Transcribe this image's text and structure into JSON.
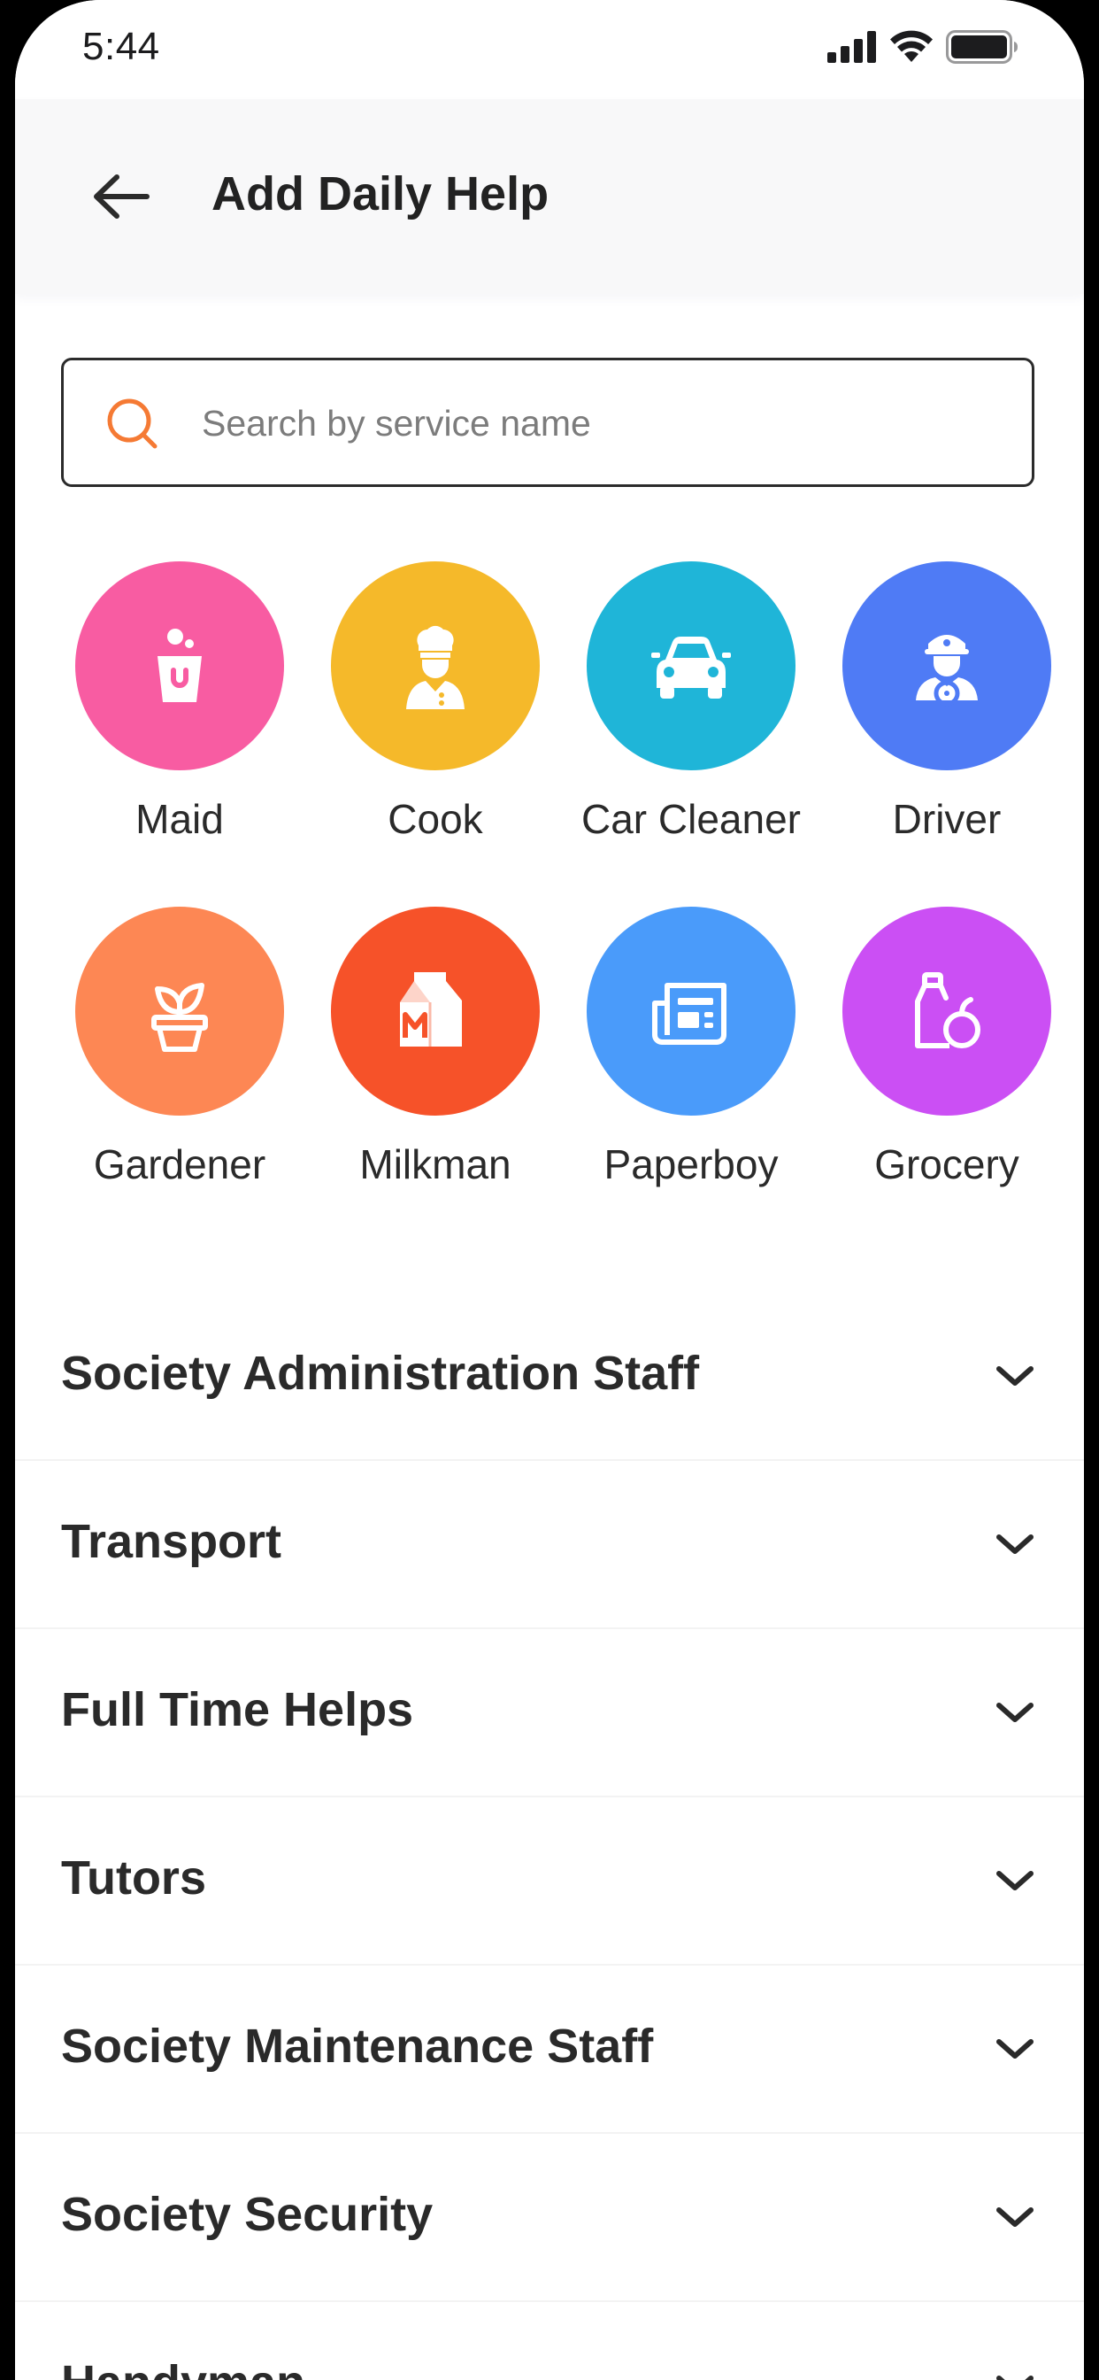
{
  "status_bar": {
    "time": "5:44",
    "icons": [
      "signal-icon",
      "wifi-icon",
      "battery-icon"
    ]
  },
  "header": {
    "back_icon": "arrow-left-icon",
    "title": "Add Daily Help"
  },
  "search": {
    "icon": "search-icon",
    "placeholder": "Search by service name",
    "value": ""
  },
  "services": [
    {
      "label": "Maid",
      "icon": "maid-icon",
      "color": "#F85CA2"
    },
    {
      "label": "Cook",
      "icon": "chef-icon",
      "color": "#F5B92A"
    },
    {
      "label": "Car Cleaner",
      "icon": "car-icon",
      "color": "#1FB5D8"
    },
    {
      "label": "Driver",
      "icon": "driver-icon",
      "color": "#4F7BF5"
    },
    {
      "label": "Gardener",
      "icon": "plant-pot-icon",
      "color": "#FD8754"
    },
    {
      "label": "Milkman",
      "icon": "milk-carton-icon",
      "color": "#F65229"
    },
    {
      "label": "Paperboy",
      "icon": "newspaper-icon",
      "color": "#4A9BFA"
    },
    {
      "label": "Grocery",
      "icon": "grocery-icon",
      "color": "#CB4FF4"
    }
  ],
  "categories": [
    {
      "label": "Society Administration Staff"
    },
    {
      "label": "Transport"
    },
    {
      "label": "Full Time Helps"
    },
    {
      "label": "Tutors"
    },
    {
      "label": "Society Maintenance Staff"
    },
    {
      "label": "Society Security"
    },
    {
      "label": "Handyman"
    }
  ]
}
